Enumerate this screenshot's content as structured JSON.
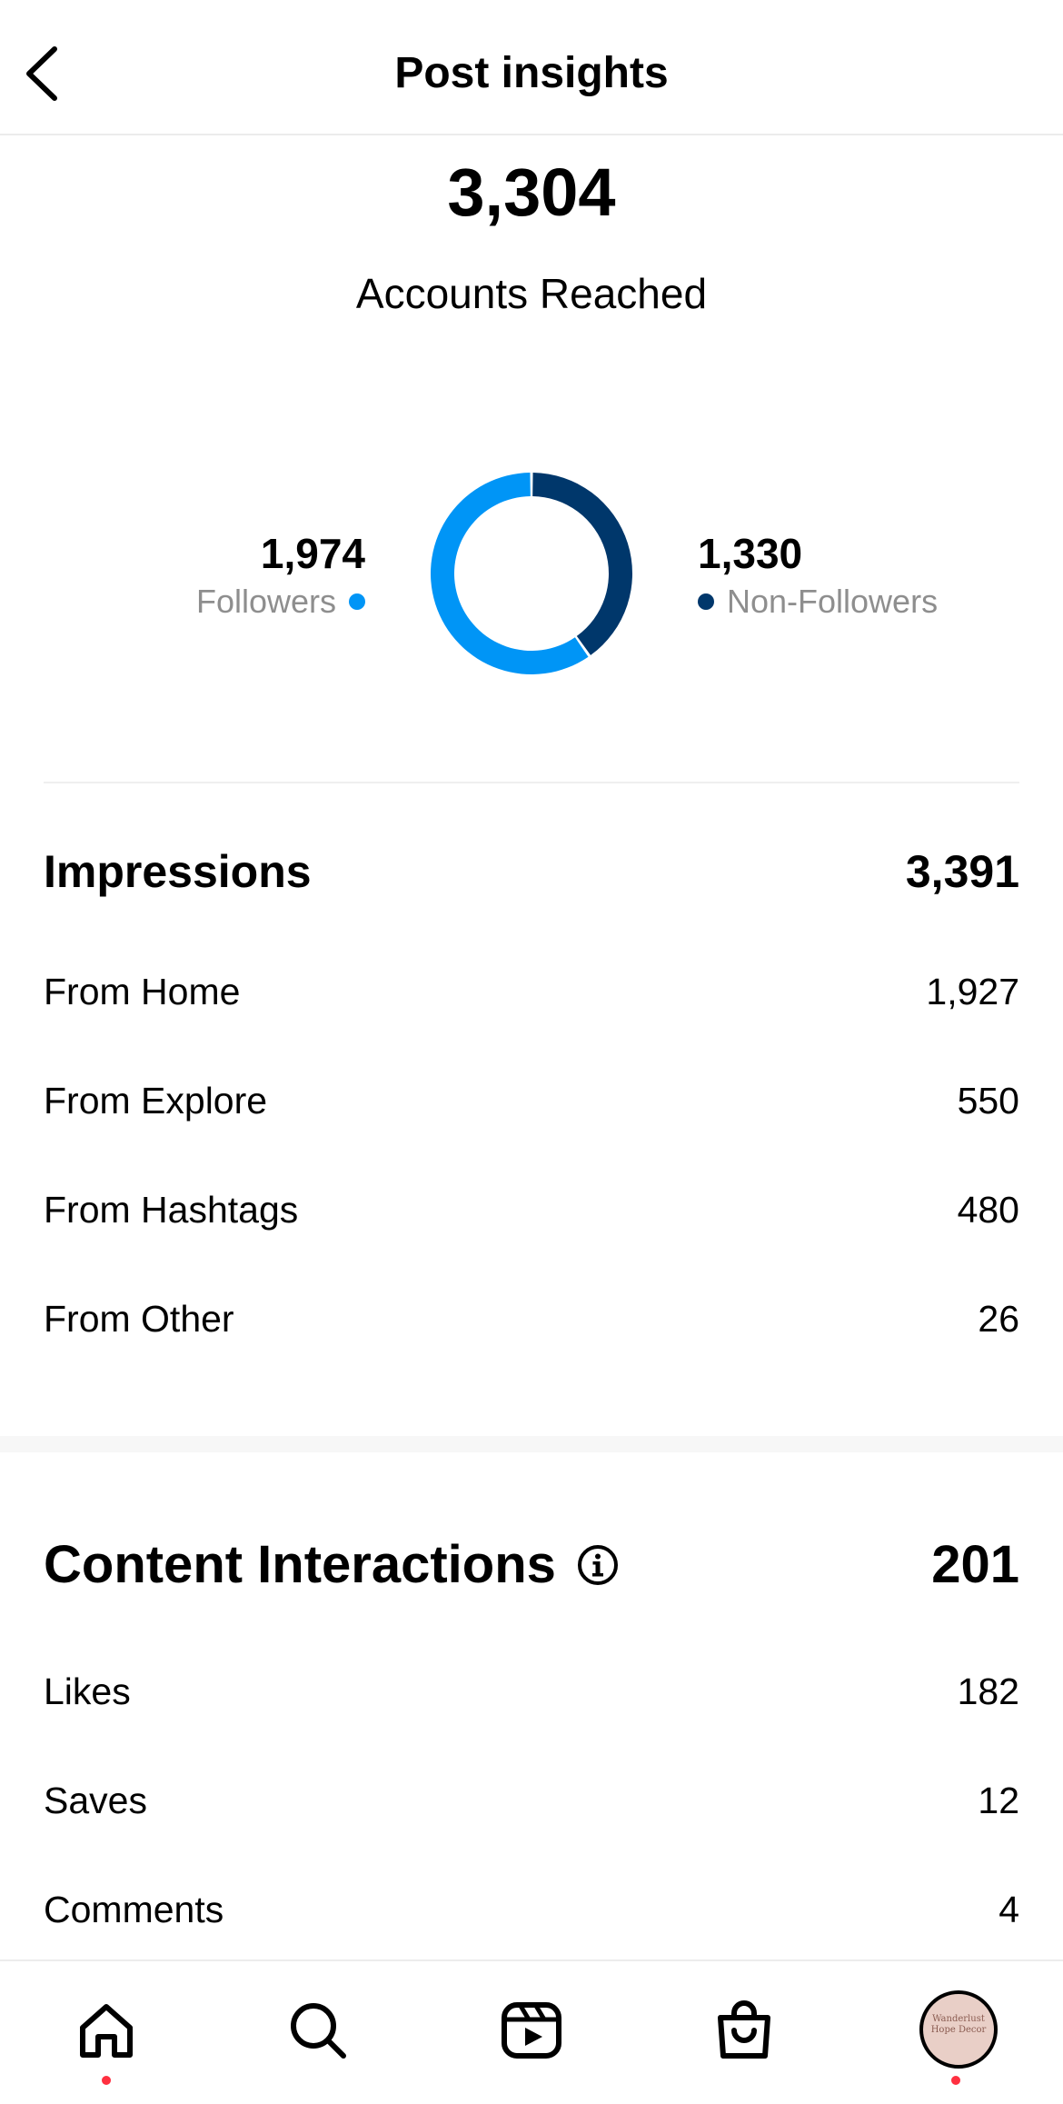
{
  "header": {
    "title": "Post insights",
    "back_icon": "chevron-left-icon"
  },
  "reach": {
    "total": "3,304",
    "label": "Accounts Reached",
    "followers": {
      "value": "1,974",
      "label": "Followers",
      "color": "#0095f6"
    },
    "non_followers": {
      "value": "1,330",
      "label": "Non-Followers",
      "color": "#00376b"
    }
  },
  "chart_data": {
    "type": "pie",
    "categories": [
      "Followers",
      "Non-Followers"
    ],
    "values": [
      1974,
      1330
    ],
    "colors": [
      "#0095f6",
      "#00376b"
    ]
  },
  "impressions": {
    "title": "Impressions",
    "total": "3,391",
    "rows": [
      {
        "label": "From Home",
        "value": "1,927"
      },
      {
        "label": "From Explore",
        "value": "550"
      },
      {
        "label": "From Hashtags",
        "value": "480"
      },
      {
        "label": "From Other",
        "value": "26"
      }
    ]
  },
  "interactions": {
    "title": "Content Interactions",
    "total": "201",
    "info_icon": "info-icon",
    "rows": [
      {
        "label": "Likes",
        "value": "182"
      },
      {
        "label": "Saves",
        "value": "12"
      },
      {
        "label": "Comments",
        "value": "4"
      }
    ]
  },
  "tabbar": {
    "items": [
      "home-icon",
      "search-icon",
      "reels-icon",
      "shop-icon",
      "profile-avatar"
    ],
    "notification_color": "#ff3040",
    "avatar_text": "Wanderlust Hope Decor"
  }
}
